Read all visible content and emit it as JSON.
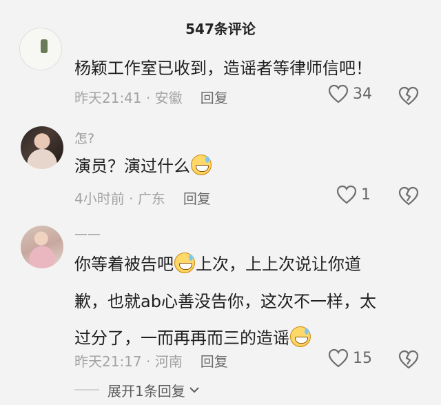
{
  "header": {
    "title": "547条评论"
  },
  "comments": [
    {
      "nickname": "",
      "text": "杨颖工作室已收到，造谣者等律师信吧！",
      "time": "昨天21:41",
      "separator": " · ",
      "location": "安徽",
      "reply": "回复",
      "likes": "34"
    },
    {
      "nickname": "怎?",
      "text": "演员？演过什么",
      "time": "4小时前",
      "separator": " · ",
      "location": "广东",
      "reply": "回复",
      "likes": "1"
    },
    {
      "nickname": "——",
      "line1": "你等着被告吧",
      "line1b": "上次，上上次说让你道",
      "line2": "歉，也就ab心善没告你，这次不一样，太",
      "line3": "过分了，一而再再而三的造谣",
      "time": "昨天21:17",
      "separator": " · ",
      "location": "河南",
      "reply": "回复",
      "likes": "15",
      "expand": "展开1条回复"
    }
  ],
  "icons": {
    "like": "heart-outline-icon",
    "dislike": "broken-heart-icon",
    "emoji": "grinning-sweat-emoji",
    "expand": "chevron-down-icon"
  }
}
